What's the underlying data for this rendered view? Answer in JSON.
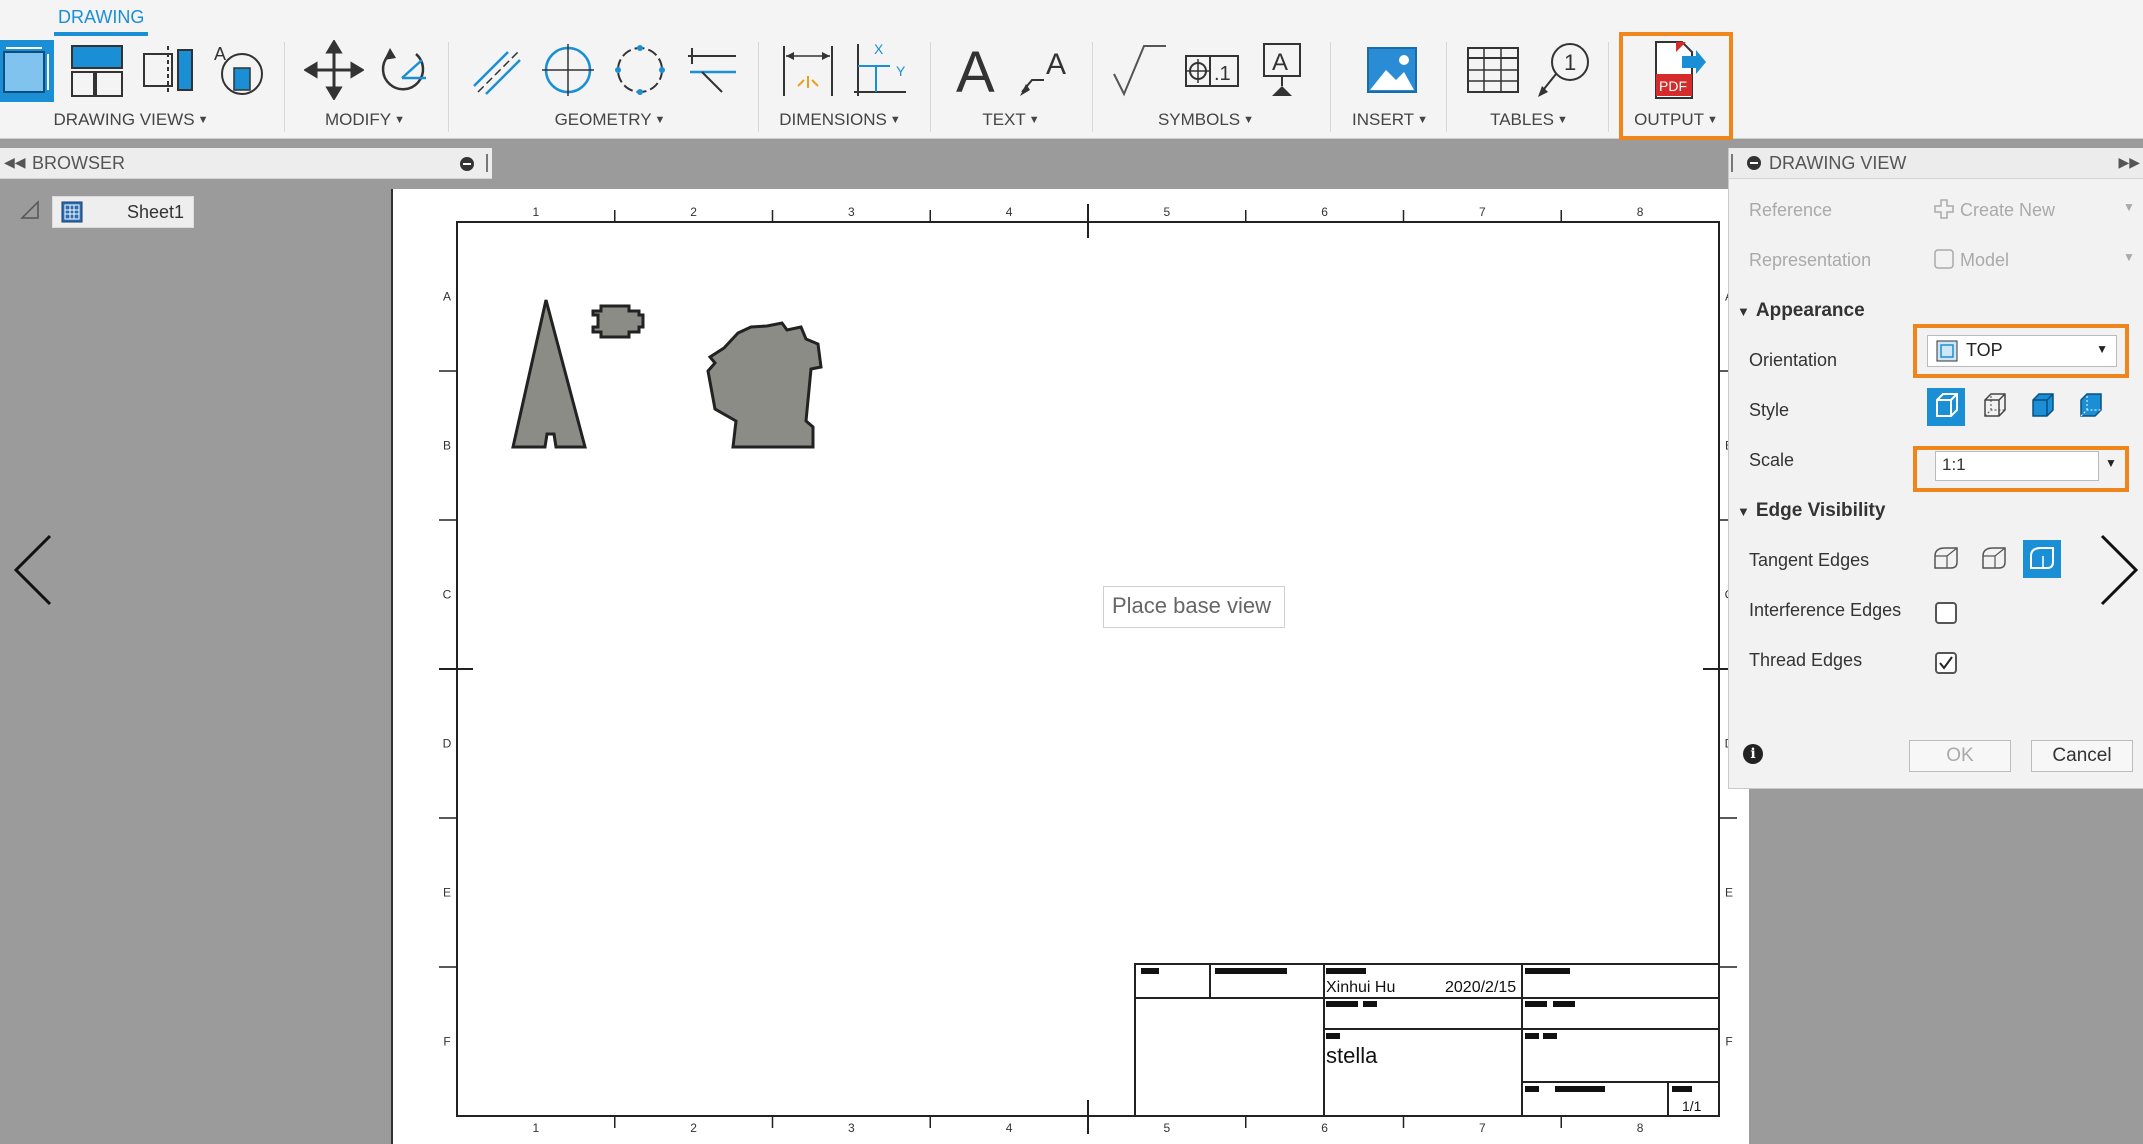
{
  "ribbon": {
    "active_tab": "DRAWING",
    "groups": {
      "drawing_views": "DRAWING VIEWS",
      "modify": "MODIFY",
      "geometry": "GEOMETRY",
      "dimensions": "DIMENSIONS",
      "text": "TEXT",
      "symbols": "SYMBOLS",
      "insert": "INSERT",
      "tables": "TABLES",
      "output": "OUTPUT"
    },
    "symbol_tool_text": ".1",
    "balloon_number": "1",
    "dimension_axes": [
      "X",
      "Y"
    ],
    "pdf_label": "PDF"
  },
  "browser": {
    "title": "BROWSER",
    "sheet_name": "Sheet1"
  },
  "sheet": {
    "columns": [
      "1",
      "2",
      "3",
      "4",
      "5",
      "6",
      "7",
      "8"
    ],
    "rows": [
      "A",
      "B",
      "C",
      "D",
      "E",
      "F"
    ],
    "tooltip": "Place base view",
    "title_block": {
      "author": "Xinhui Hu",
      "date": "2020/2/15",
      "title": "stella",
      "sheet_count": "1/1"
    }
  },
  "dialog": {
    "title": "DRAWING VIEW",
    "reference_label": "Reference",
    "reference_value": "Create New",
    "representation_label": "Representation",
    "representation_value": "Model",
    "appearance_section": "Appearance",
    "orientation_label": "Orientation",
    "orientation_value": "TOP",
    "style_label": "Style",
    "scale_label": "Scale",
    "scale_value": "1:1",
    "edge_visibility_section": "Edge Visibility",
    "tangent_edges_label": "Tangent Edges",
    "interference_edges_label": "Interference Edges",
    "thread_edges_label": "Thread Edges",
    "interference_edges_checked": false,
    "thread_edges_checked": true,
    "ok_label": "OK",
    "cancel_label": "Cancel"
  },
  "colors": {
    "accent_blue": "#1b8fd6",
    "highlight_orange": "#f0861b",
    "part_fill": "#8c8c86",
    "pdf_red": "#d62b2b"
  }
}
